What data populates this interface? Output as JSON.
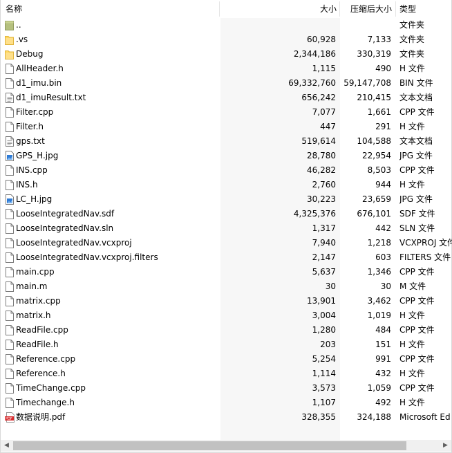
{
  "columns": {
    "name": "名称",
    "size": "大小",
    "compressed": "压缩后大小",
    "type": "类型"
  },
  "files": [
    {
      "name": "..",
      "size": "",
      "compressed": "",
      "type": "文件夹",
      "icon": "parent-folder"
    },
    {
      "name": ".vs",
      "size": "60,928",
      "compressed": "7,133",
      "type": "文件夹",
      "icon": "folder"
    },
    {
      "name": "Debug",
      "size": "2,344,186",
      "compressed": "330,319",
      "type": "文件夹",
      "icon": "folder"
    },
    {
      "name": "AllHeader.h",
      "size": "1,115",
      "compressed": "490",
      "type": "H 文件",
      "icon": "file"
    },
    {
      "name": "d1_imu.bin",
      "size": "69,332,760",
      "compressed": "59,147,708",
      "type": "BIN 文件",
      "icon": "file"
    },
    {
      "name": "d1_imuResult.txt",
      "size": "656,242",
      "compressed": "210,415",
      "type": "文本文档",
      "icon": "text-file"
    },
    {
      "name": "Filter.cpp",
      "size": "7,077",
      "compressed": "1,661",
      "type": "CPP 文件",
      "icon": "file"
    },
    {
      "name": "Filter.h",
      "size": "447",
      "compressed": "291",
      "type": "H 文件",
      "icon": "file"
    },
    {
      "name": "gps.txt",
      "size": "519,614",
      "compressed": "104,588",
      "type": "文本文档",
      "icon": "text-file"
    },
    {
      "name": "GPS_H.jpg",
      "size": "28,780",
      "compressed": "22,954",
      "type": "JPG 文件",
      "icon": "image-file"
    },
    {
      "name": "INS.cpp",
      "size": "46,282",
      "compressed": "8,503",
      "type": "CPP 文件",
      "icon": "file"
    },
    {
      "name": "INS.h",
      "size": "2,760",
      "compressed": "944",
      "type": "H 文件",
      "icon": "file"
    },
    {
      "name": "LC_H.jpg",
      "size": "30,223",
      "compressed": "23,659",
      "type": "JPG 文件",
      "icon": "image-file"
    },
    {
      "name": "LooseIntegratedNav.sdf",
      "size": "4,325,376",
      "compressed": "676,101",
      "type": "SDF 文件",
      "icon": "file"
    },
    {
      "name": "LooseIntegratedNav.sln",
      "size": "1,317",
      "compressed": "442",
      "type": "SLN 文件",
      "icon": "file"
    },
    {
      "name": "LooseIntegratedNav.vcxproj",
      "size": "7,940",
      "compressed": "1,218",
      "type": "VCXPROJ 文件",
      "icon": "file"
    },
    {
      "name": "LooseIntegratedNav.vcxproj.filters",
      "size": "2,147",
      "compressed": "603",
      "type": "FILTERS 文件",
      "icon": "file"
    },
    {
      "name": "main.cpp",
      "size": "5,637",
      "compressed": "1,346",
      "type": "CPP 文件",
      "icon": "file"
    },
    {
      "name": "main.m",
      "size": "30",
      "compressed": "30",
      "type": "M 文件",
      "icon": "file"
    },
    {
      "name": "matrix.cpp",
      "size": "13,901",
      "compressed": "3,462",
      "type": "CPP 文件",
      "icon": "file"
    },
    {
      "name": "matrix.h",
      "size": "3,004",
      "compressed": "1,019",
      "type": "H 文件",
      "icon": "file"
    },
    {
      "name": "ReadFile.cpp",
      "size": "1,280",
      "compressed": "484",
      "type": "CPP 文件",
      "icon": "file"
    },
    {
      "name": "ReadFile.h",
      "size": "203",
      "compressed": "151",
      "type": "H 文件",
      "icon": "file"
    },
    {
      "name": "Reference.cpp",
      "size": "5,254",
      "compressed": "991",
      "type": "CPP 文件",
      "icon": "file"
    },
    {
      "name": "Reference.h",
      "size": "1,114",
      "compressed": "432",
      "type": "H 文件",
      "icon": "file"
    },
    {
      "name": "TimeChange.cpp",
      "size": "3,573",
      "compressed": "1,059",
      "type": "CPP 文件",
      "icon": "file"
    },
    {
      "name": "Timechange.h",
      "size": "1,107",
      "compressed": "492",
      "type": "H 文件",
      "icon": "file"
    },
    {
      "name": "数据说明.pdf",
      "size": "328,355",
      "compressed": "324,188",
      "type": "Microsoft Ed",
      "icon": "pdf-file"
    }
  ]
}
